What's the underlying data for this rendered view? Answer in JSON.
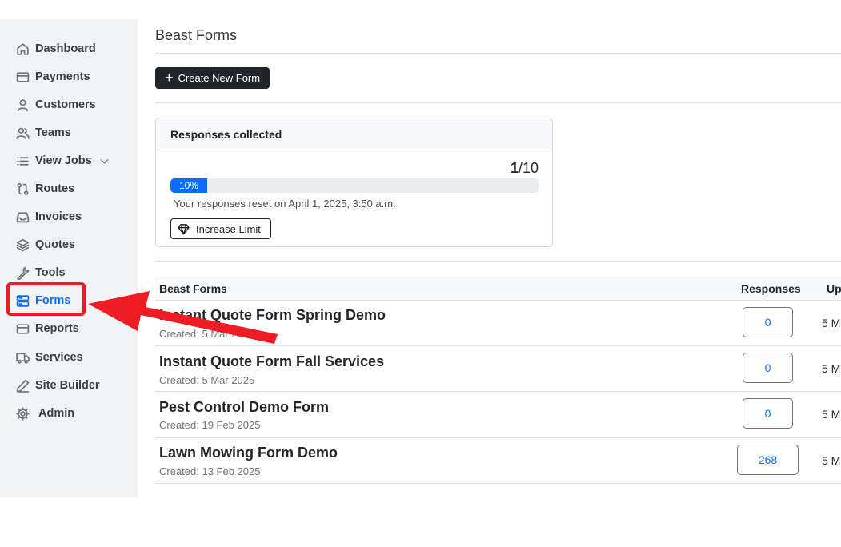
{
  "sidebar": {
    "items": [
      {
        "label": "Dashboard",
        "icon": "home-icon"
      },
      {
        "label": "Payments",
        "icon": "credit-card-icon"
      },
      {
        "label": "Customers",
        "icon": "user-icon"
      },
      {
        "label": "Teams",
        "icon": "users-icon"
      },
      {
        "label": "View Jobs",
        "icon": "list-icon"
      },
      {
        "label": "Routes",
        "icon": "route-icon"
      },
      {
        "label": "Invoices",
        "icon": "inbox-icon"
      },
      {
        "label": "Quotes",
        "icon": "layers-icon"
      },
      {
        "label": "Tools",
        "icon": "wrench-icon"
      },
      {
        "label": "Forms",
        "icon": "form-icon"
      },
      {
        "label": "Reports",
        "icon": "report-icon"
      },
      {
        "label": "Services",
        "icon": "truck-icon"
      },
      {
        "label": "Site Builder",
        "icon": "pen-icon"
      },
      {
        "label": "Admin",
        "icon": "gear-icon"
      }
    ],
    "active": "Forms",
    "accent_color": "#0d6efd",
    "annotation_color": "#ee1c24"
  },
  "header": {
    "title": "Beast Forms",
    "create_button": "Create New Form"
  },
  "responses_card": {
    "title": "Responses collected",
    "used": "1",
    "limit": "/10",
    "progress_label": "10%",
    "progress_value": 0.1,
    "reset_text": "Your responses reset on April 1, 2025, 3:50 a.m.",
    "increase_button": "Increase Limit"
  },
  "table": {
    "headers": {
      "name": "Beast Forms",
      "responses": "Responses",
      "updated": "Up"
    },
    "rows": [
      {
        "name": "Instant Quote Form Spring Demo",
        "created": "Created: 5 Mar 2025",
        "responses": "0",
        "updated": "5 M"
      },
      {
        "name": "Instant Quote Form Fall Services",
        "created": "Created: 5 Mar 2025",
        "responses": "0",
        "updated": "5 M"
      },
      {
        "name": "Pest Control Demo Form",
        "created": "Created: 19 Feb 2025",
        "responses": "0",
        "updated": "5 M"
      },
      {
        "name": "Lawn Mowing Form Demo",
        "created": "Created: 13 Feb 2025",
        "responses": "268",
        "updated": "5 M"
      }
    ]
  }
}
